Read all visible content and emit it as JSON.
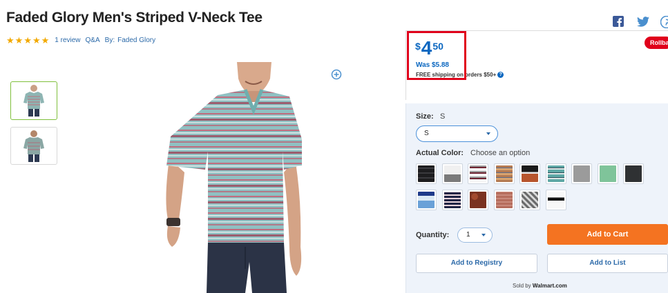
{
  "product": {
    "title": "Faded Glory Men's Striped V-Neck Tee",
    "rating_stars": 5,
    "reviews_link": "1 review",
    "qa_link": "Q&A",
    "by_label": "By:",
    "brand_link": "Faded Glory"
  },
  "pricing": {
    "currency": "$",
    "whole": "4",
    "cents": "50",
    "was": "Was $5.88",
    "shipping": "FREE shipping on orders $50+",
    "rollback_badge": "Rollback",
    "highlight_color": "#e0001b",
    "price_color": "#0b67c0"
  },
  "options": {
    "size_label": "Size:",
    "size_value": "S",
    "size_select_value": "S",
    "color_label": "Actual Color:",
    "color_value": "Choose an option",
    "swatches": [
      {
        "name": "black-stripe",
        "bg": "repeating-linear-gradient(0deg,#1d1d1f 0 5px,#3a3a3e 5px 7px)"
      },
      {
        "name": "white-gray",
        "bg": "linear-gradient(180deg,#f0f0f0 0 55%,#7a7a7a 55% 100%)"
      },
      {
        "name": "white-maroon-stripe",
        "bg": "repeating-linear-gradient(0deg,#f5f5f5 0 4px,#6e2230 4px 6px,#9a9a9a 6px 8px)"
      },
      {
        "name": "tan-orange-stripe",
        "bg": "repeating-linear-gradient(0deg,#b47a52 0 3px,#d9a36e 3px 6px,#5a6a8a 6px 7px)"
      },
      {
        "name": "black-orange",
        "bg": "linear-gradient(180deg,#1a1a1a 0 40%,#e8e8e8 40% 50%,#b7552d 50% 100%)"
      },
      {
        "name": "teal-stripe",
        "bg": "repeating-linear-gradient(0deg,#5fa8a6 0 4px,#dfe7e7 4px 6px,#2d4f5b 6px 7px)"
      },
      {
        "name": "heather-gray",
        "bg": "#9b9b9b"
      },
      {
        "name": "mint-green",
        "bg": "#7fc49a"
      },
      {
        "name": "charcoal",
        "bg": "#2f3133"
      },
      {
        "name": "blue-white",
        "bg": "linear-gradient(180deg,#1e3a8a 0 25%,#dbe9f5 25% 55%,#6aa1d8 55% 100%)"
      },
      {
        "name": "navy-pink-stripe",
        "bg": "repeating-linear-gradient(0deg,#1f2344 0 3px,#e9d5dc 3px 5px)"
      },
      {
        "name": "rust-pattern",
        "bg": "radial-gradient(circle at 30% 30%,#a24a2e 0 20%,#7a3220 20% 100%)"
      },
      {
        "name": "dusty-red-stripe",
        "bg": "repeating-linear-gradient(0deg,#b66d5d 0 3px,#c98a7c 3px 5px)"
      },
      {
        "name": "gray-geometric",
        "bg": "repeating-linear-gradient(45deg,#6b6b6b 0 3px,#d8d8d8 3px 6px)"
      },
      {
        "name": "white-black-band",
        "bg": "linear-gradient(180deg,#f8f8f8 0 35%,#111111 35% 55%,#f8f8f8 55% 100%)"
      }
    ],
    "quantity_label": "Quantity:",
    "quantity_value": "1"
  },
  "actions": {
    "add_to_cart": "Add to Cart",
    "add_to_registry": "Add to Registry",
    "add_to_list": "Add to List",
    "sold_by_prefix": "Sold by",
    "seller": "Walmart.com",
    "cart_color": "#f47321"
  },
  "social": {
    "icons": [
      "facebook-icon",
      "twitter-icon",
      "pinterest-icon"
    ]
  }
}
